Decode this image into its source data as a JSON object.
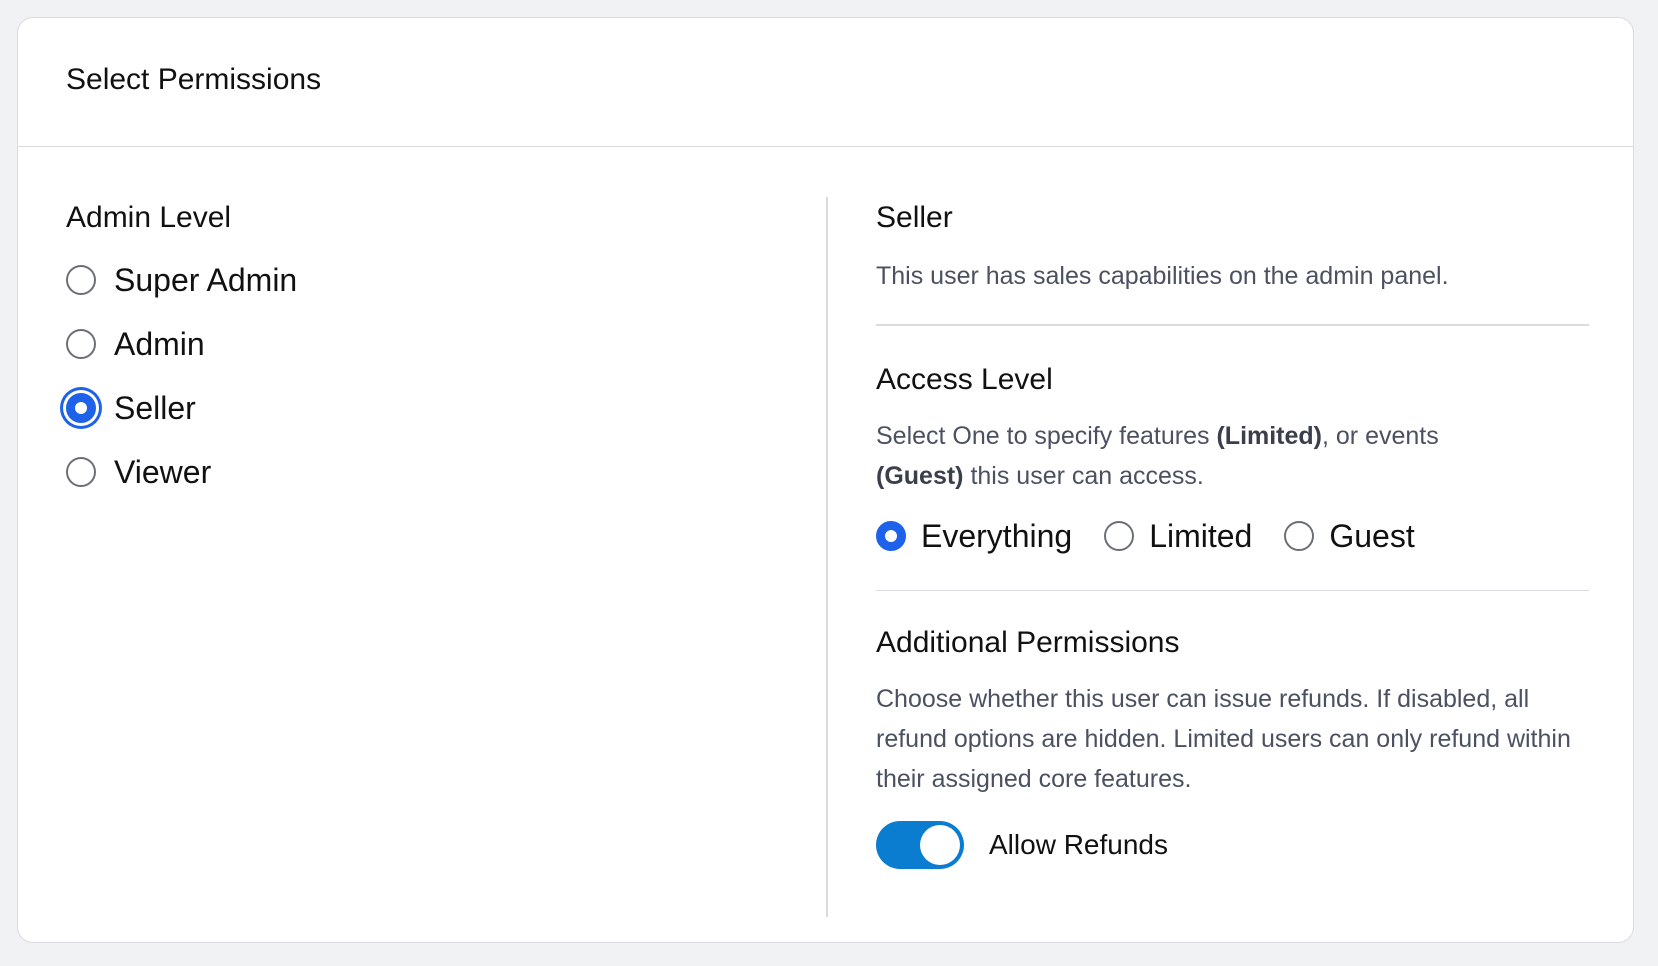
{
  "card": {
    "title": "Select Permissions"
  },
  "admin_level": {
    "title": "Admin Level",
    "options": [
      {
        "label": "Super Admin",
        "checked": false
      },
      {
        "label": "Admin",
        "checked": false
      },
      {
        "label": "Seller",
        "checked": true
      },
      {
        "label": "Viewer",
        "checked": false
      }
    ]
  },
  "role_info": {
    "title": "Seller",
    "description": "This user has sales capabilities on the admin panel."
  },
  "access_level": {
    "title": "Access Level",
    "desc_part1": "Select One to specify features ",
    "desc_bold1": "(Limited)",
    "desc_part2": ", or events ",
    "desc_bold2": "(Guest)",
    "desc_part3": " this user can access.",
    "options": [
      {
        "label": "Everything",
        "checked": true
      },
      {
        "label": "Limited",
        "checked": false
      },
      {
        "label": "Guest",
        "checked": false
      }
    ]
  },
  "additional_permissions": {
    "title": "Additional Permissions",
    "description": "Choose whether this user can issue refunds. If disabled, all refund options are hidden. Limited users can only refund within their assigned core features.",
    "toggle_label": "Allow Refunds",
    "toggle_on": true
  },
  "colors": {
    "accent": "#1f62ea",
    "toggle": "#0a7dd1"
  }
}
